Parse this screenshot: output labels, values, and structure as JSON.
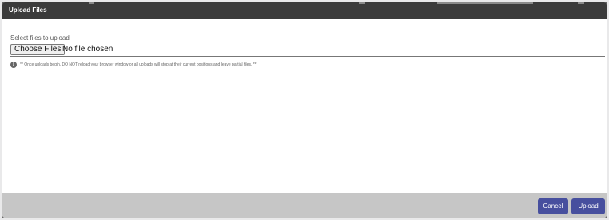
{
  "dialog": {
    "title": "Upload Files"
  },
  "form": {
    "label": "Select files to upload",
    "choose_button": "Choose Files",
    "file_status": "No file chosen"
  },
  "note": {
    "icon": "info-icon",
    "text": "** Once uploads begin, DO NOT reload your browser window or all uploads will stop at their current positions and leave partial files. **"
  },
  "footer": {
    "cancel_label": "Cancel",
    "upload_label": "Upload"
  },
  "colors": {
    "titlebar": "#3b3b3b",
    "footer": "#c6c6c6",
    "button": "#474f9e"
  }
}
